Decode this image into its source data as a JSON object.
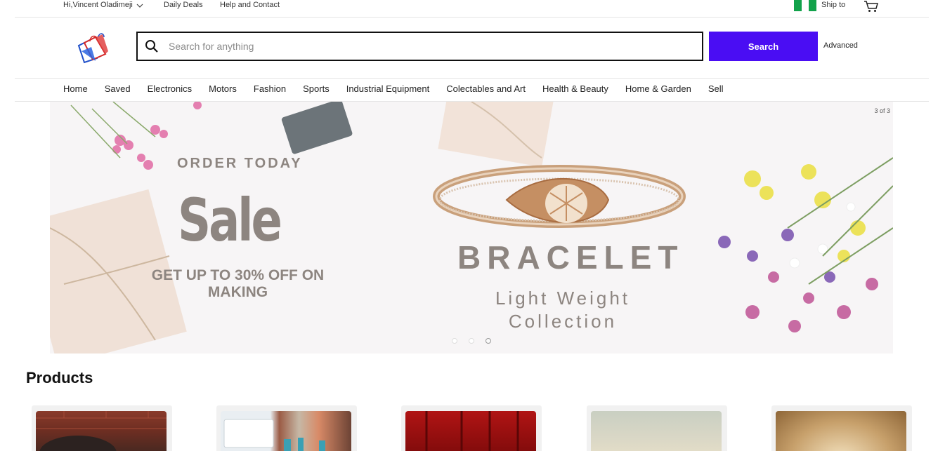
{
  "topbar": {
    "greeting": "Hi,Vincent Oladimeji",
    "daily_deals": "Daily Deals",
    "help": "Help and Contact",
    "ship_to": "Ship to"
  },
  "search": {
    "placeholder": "Search for anything",
    "button": "Search",
    "advanced": "Advanced"
  },
  "nav": {
    "items": [
      "Home",
      "Saved",
      "Electronics",
      "Motors",
      "Fashion",
      "Sports",
      "Industrial Equipment",
      "Colectables and Art",
      "Health & Beauty",
      "Home & Garden",
      "Sell"
    ]
  },
  "banner": {
    "counter": "3 of 3",
    "order_today": "ORDER TODAY",
    "sale": "Sale",
    "offer": "GET UP TO 30% OFF ON MAKING",
    "product": "BRACELET",
    "line1": "Light Weight",
    "line2": "Collection",
    "slides": 3,
    "active_slide": 3
  },
  "products": {
    "title": "Products"
  },
  "colors": {
    "accent": "#4a0df3",
    "banner_text": "#8d8580"
  }
}
